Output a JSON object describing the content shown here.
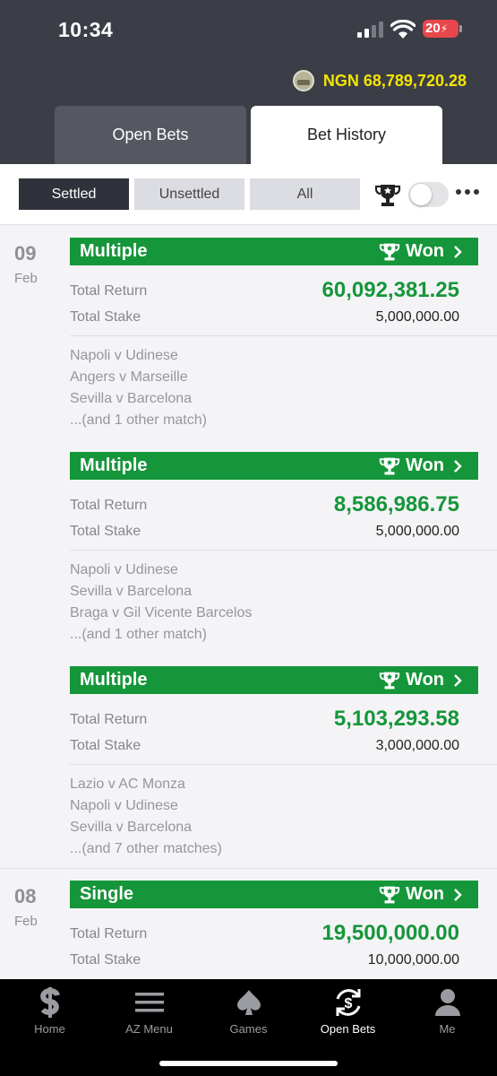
{
  "status_bar": {
    "time": "10:34",
    "battery": "20"
  },
  "balance": {
    "text": "NGN 68,789,720.28"
  },
  "tabs": [
    {
      "label": "Open Bets",
      "active": false
    },
    {
      "label": "Bet History",
      "active": true
    }
  ],
  "filters": {
    "segments": [
      {
        "label": "Settled",
        "active": true
      },
      {
        "label": "Unsettled",
        "active": false
      },
      {
        "label": "All",
        "active": false
      }
    ],
    "won_only_toggle": false
  },
  "labels": {
    "total_return": "Total Return",
    "total_stake": "Total Stake"
  },
  "days": [
    {
      "day": "09",
      "month": "Feb",
      "bets": [
        {
          "type": "Multiple",
          "status": "Won",
          "total_return": "60,092,381.25",
          "total_stake": "5,000,000.00",
          "matches": [
            "Napoli v Udinese",
            "Angers v Marseille",
            "Sevilla v Barcelona",
            "...(and 1 other match)"
          ]
        },
        {
          "type": "Multiple",
          "status": "Won",
          "total_return": "8,586,986.75",
          "total_stake": "5,000,000.00",
          "matches": [
            "Napoli v Udinese",
            "Sevilla v Barcelona",
            "Braga v Gil Vicente Barcelos",
            "...(and 1 other match)"
          ]
        },
        {
          "type": "Multiple",
          "status": "Won",
          "total_return": "5,103,293.58",
          "total_stake": "3,000,000.00",
          "matches": [
            "Lazio v AC Monza",
            "Napoli v Udinese",
            "Sevilla v Barcelona",
            "...(and 7 other matches)"
          ]
        }
      ]
    },
    {
      "day": "08",
      "month": "Feb",
      "bets": [
        {
          "type": "Single",
          "status": "Won",
          "total_return": "19,500,000.00",
          "total_stake": "10,000,000.00",
          "matches": []
        }
      ]
    }
  ],
  "bottom_nav": [
    {
      "label": "Home",
      "icon": "dollar-s-icon",
      "active": false
    },
    {
      "label": "AZ Menu",
      "icon": "hamburger-icon",
      "active": false
    },
    {
      "label": "Games",
      "icon": "spade-icon",
      "active": false
    },
    {
      "label": "Open Bets",
      "icon": "bets-refresh-icon",
      "active": true
    },
    {
      "label": "Me",
      "icon": "user-icon",
      "active": false
    }
  ],
  "colors": {
    "won_green": "#15963a",
    "header": "#3b3e47",
    "balance": "#f5e500"
  }
}
